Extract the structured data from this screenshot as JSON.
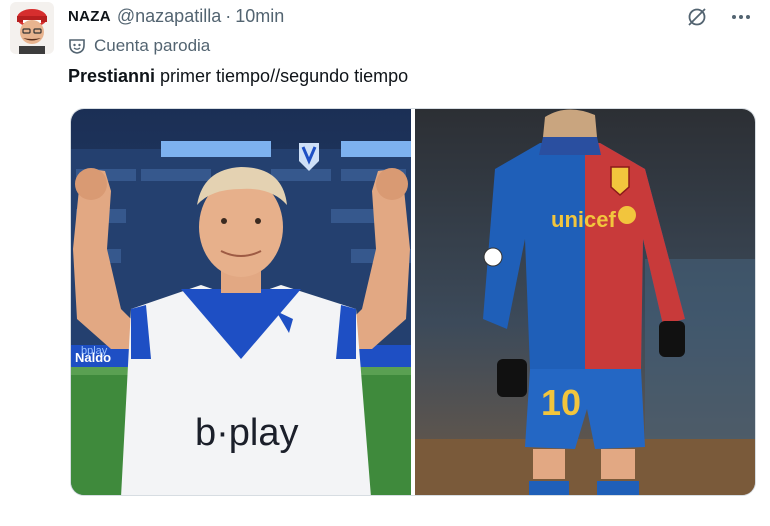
{
  "tweet": {
    "display_name": "NAZA",
    "handle": "@nazapatilla",
    "separator": "·",
    "time": "10min",
    "label": "Cuenta parodia",
    "text_bold": "Prestianni",
    "text_rest": " primer tiempo//segundo tiempo"
  },
  "media": {
    "left": {
      "stadium_text_a": "Naldo",
      "stadium_text_b": "bplay",
      "shirt_sponsor": "b·play"
    },
    "right": {
      "shirt_sponsor": "unicef",
      "shirt_number": "10"
    }
  },
  "colors": {
    "text_primary": "#0f1419",
    "text_secondary": "#536471",
    "velez_blue": "#1e4fc4",
    "barca_blue": "#1f5fb8",
    "barca_red": "#c83a3a"
  },
  "icons": [
    "avatar-icon",
    "parody-mask-icon",
    "grok-icon",
    "more-icon"
  ]
}
